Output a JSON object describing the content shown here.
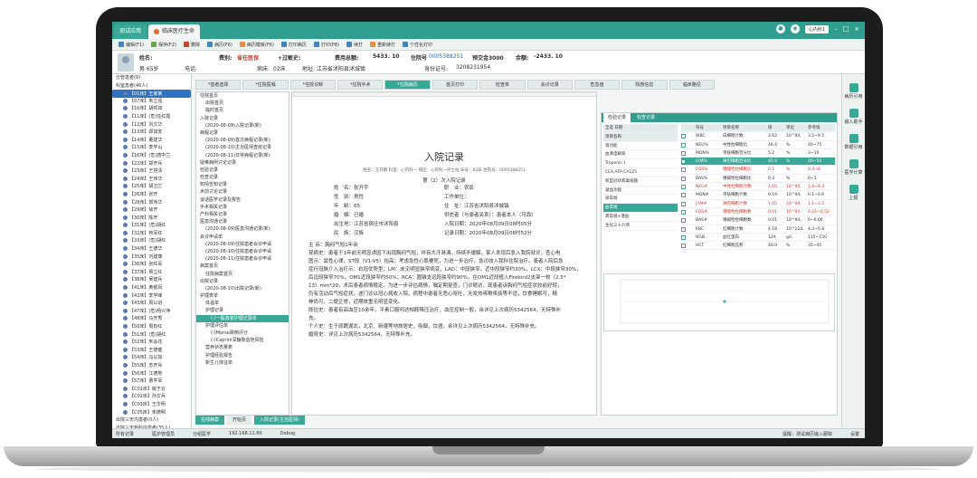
{
  "tabs": [
    {
      "label": "测试应用"
    },
    {
      "label": "临床医疗生命"
    }
  ],
  "topright": {
    "dept": "心内科1"
  },
  "toolbar": [
    {
      "label": "编辑(F1)",
      "c": ""
    },
    {
      "label": "保存(F2)",
      "c": "g"
    },
    {
      "label": "删除",
      "c": "r"
    },
    {
      "label": "病历(F6)",
      "c": ""
    },
    {
      "label": "病历模板(F6)",
      "c": "o"
    },
    {
      "label": "打印病历",
      "c": ""
    },
    {
      "label": "打印(P8)",
      "c": ""
    },
    {
      "label": "续打",
      "c": ""
    },
    {
      "label": "重新续打",
      "c": "o"
    },
    {
      "label": "个性化打印",
      "c": ""
    }
  ],
  "patient": {
    "name_label": "姓名:",
    "gender_age": "男  65岁",
    "phone_label": "电话:",
    "fee_type_label": "费别:",
    "fee_type": "省任医保",
    "allergy_label": "+过敏史:",
    "ward_label": "病床:",
    "ward": "02床",
    "address": "地址: 江苏省沭阳县沭城镇",
    "total_label": "费用总额:",
    "total": "5433. 10",
    "inpatient_label": "住院号",
    "inpatient_no": "0005388251",
    "deposit_label": "预交金3000",
    "balance_label": "余额:",
    "balance": "-2433. 10",
    "id_label": "身份证号:",
    "id_no": "3208231954"
  },
  "left_tree": [
    {
      "t": "分管患者(0)",
      "grp": true
    },
    {
      "t": "科室患者(46人)",
      "grp": true
    },
    {
      "t": "【01床】王某某",
      "sel": true
    },
    {
      "t": "【07床】朱立强"
    },
    {
      "t": "【10床】胡邦如"
    },
    {
      "t": "【11床】(危)任红霞"
    },
    {
      "t": "【12床】刘文华"
    },
    {
      "t": "【13床】郑如安"
    },
    {
      "t": "【14床】董建华"
    },
    {
      "t": "【15床】李学山"
    },
    {
      "t": "【16床】(危)唐中兰"
    },
    {
      "t": "【22床】郑开兵"
    },
    {
      "t": "【23床】王悦清"
    },
    {
      "t": "【24床】王伟华"
    },
    {
      "t": "【25床】胡卫兰"
    },
    {
      "t": "【26床】张开"
    },
    {
      "t": "【28床】郭伟华"
    },
    {
      "t": "【29床】徐开"
    },
    {
      "t": "【30床】陈开"
    },
    {
      "t": "【31床】(危)胡红"
    },
    {
      "t": "【32床】蒋军红"
    },
    {
      "t": "【33床】(危)胡红"
    },
    {
      "t": "【34床】王德华"
    },
    {
      "t": "【35床】刘建康"
    },
    {
      "t": "【36床】张红军"
    },
    {
      "t": "【37床】周立红"
    },
    {
      "t": "【38床】吴建兵"
    },
    {
      "t": "【41床】黄银凤"
    },
    {
      "t": "【42床】李学峰"
    },
    {
      "t": "【43床】周以进"
    },
    {
      "t": "【47床】(危)杨兴萍"
    },
    {
      "t": "【48床】马开秀"
    },
    {
      "t": "【50床】周有红"
    },
    {
      "t": "【51床】(危)胡红"
    },
    {
      "t": "【52床】朱会花"
    },
    {
      "t": "【53床】王德健"
    },
    {
      "t": "【54床】马以加"
    },
    {
      "t": "【55床】苏开兵"
    },
    {
      "t": "【56床】江德地"
    },
    {
      "t": "【57床】曹学军"
    },
    {
      "t": "【C01床】姚于云"
    },
    {
      "t": "【C02床】孙文兵"
    },
    {
      "t": "【C03床】王华明"
    },
    {
      "t": "【C05床】朱德明"
    },
    {
      "t": "出院三天内患者(0人)",
      "grp": true
    },
    {
      "t": "出院三天到科内患者(35人)",
      "grp": true
    },
    {
      "t": "08-13【内科】陈月芳"
    },
    {
      "t": "08-12【内科】李红"
    },
    {
      "t": "08-11【内科】廖振远"
    }
  ],
  "navtabs": [
    {
      "t": "*患者选择"
    },
    {
      "t": "*住院医嘱"
    },
    {
      "t": "*住院诊断"
    },
    {
      "t": "*住院手术"
    },
    {
      "t": "*住院病历",
      "active": true
    },
    {
      "t": "首页打印"
    },
    {
      "t": "检查单"
    },
    {
      "t": "会诊记录"
    },
    {
      "t": "危急值"
    },
    {
      "t": "院感信息"
    },
    {
      "t": "临床路径"
    }
  ],
  "doctree": [
    {
      "t": "住院首页",
      "l": 1
    },
    {
      "t": "出院首页",
      "l": 2
    },
    {
      "t": "临时首页",
      "l": 2
    },
    {
      "t": "入院记录",
      "l": 1
    },
    {
      "t": "(2020-08-09)入院记录(新)",
      "l": 2
    },
    {
      "t": "病程记录",
      "l": 1
    },
    {
      "t": "(2020-08-09)首次病程记录(新)",
      "l": 2
    },
    {
      "t": "(2020-08-10)主治医师查房记录",
      "l": 2
    },
    {
      "t": "(2020-08-11)日常病程记录(新)",
      "l": 2
    },
    {
      "t": "疑难病例讨论记录",
      "l": 1
    },
    {
      "t": "检验记录",
      "l": 1
    },
    {
      "t": "检查记录",
      "l": 1
    },
    {
      "t": "知情告知记录",
      "l": 1
    },
    {
      "t": "术前讨论记录",
      "l": 1
    },
    {
      "t": "谈话医学记录及报告",
      "l": 1
    },
    {
      "t": "手术相关记录",
      "l": 1
    },
    {
      "t": "产科相关记录",
      "l": 1
    },
    {
      "t": "医患沟通记录",
      "l": 1
    },
    {
      "t": "(2020-08-09)医患沟通记录(新)",
      "l": 2
    },
    {
      "t": "会诊申请单",
      "l": 1
    },
    {
      "t": "(2020-08-09)住院患者会诊申请",
      "l": 2
    },
    {
      "t": "(2020-08-10)住院患者会诊申请",
      "l": 2
    },
    {
      "t": "(2020-08-11)住院患者会诊申请",
      "l": 2
    },
    {
      "t": "病案首页",
      "l": 1
    },
    {
      "t": "住院病案首页",
      "l": 2
    },
    {
      "t": "出院记录",
      "l": 1
    },
    {
      "t": "(2020-08-10)出院记录(新)",
      "l": 2
    },
    {
      "t": "护理表单",
      "l": 1
    },
    {
      "t": "体温单",
      "l": 2
    },
    {
      "t": "护理记录",
      "l": 2
    },
    {
      "t": "(-)一般患者护理记录单",
      "l": 3,
      "hl": true
    },
    {
      "t": "护理评估单",
      "l": 2
    },
    {
      "t": "(-)Morse跌倒评分",
      "l": 3
    },
    {
      "t": "(-)Caprini深静脉血栓风险",
      "l": 3
    },
    {
      "t": "营养状态量表",
      "l": 2
    },
    {
      "t": "护理经验报告",
      "l": 2
    },
    {
      "t": "新生儿体征单",
      "l": 2
    }
  ],
  "editor": {
    "title": "入院记录",
    "subtitle": "姓名：王开鹏   科室：心内科一   病区：心内科一护士站   床号：02床   住院号：0005388251",
    "ordinal": "第（2）次入院记录",
    "fields": [
      "姓　名：张开宇",
      "职　业：农民",
      "性　别：男性",
      "工作单位：",
      "年　龄：65",
      "住　址：江苏省沭阳县沭城镇",
      "婚　姻：已婚",
      "供史者（与患者关系）：患者本人（可靠）",
      "出生地：江苏省宿迁市沭阳县",
      "入院日期：2020年08月09日08时05分",
      "民　族：汉族",
      "记录日期：2020年08月09日08时52分"
    ],
    "lines": [
      "主  诉：胸闷气短1年余",
      "现病史：患者于1年前无明显诱因下出现胸闷气短，伴有大汗淋漓，持续不缓解，家人发现后急入我院就诊，查心电",
      "图示：窦性心律，ST段（V1-V5）抬高；考虑急性心肌梗死，为进一步治疗，急诊收入我科住院治疗。患者入院后急",
      "症行冠脉介入治疗示：右冠优势型；LM：未见明显狭窄病变，LAD：中段狭窄，近中段狭窄约30%，LCX：中段狭窄30%，",
      "后远段狭窄70%，OM1近段狭窄约50%；RCA：圆锥支远段狭窄约90%，在OM1近段植入Firebird2支架一枚（2.5*",
      "13）mm*29，术后患者病情稳定。为进一步评估病情，嘱定期复查，门诊随访，现患者诉胸闷气短症状较前好转，",
      "仍有活动后气短症状，遂门诊以冠心病收入院。病程中患者无恶心呕吐，无发热咳嗽咳痰等不适，饮食睡眠可，精",
      "神尚可，二便正常，近期体重无明显变化。",
      "既往史：患者有高血压10余年，平素口服吲达帕胺降压治疗，血压控制一般，余详见上次病历5342564，无特殊补",
      "充。",
      "个人史：生于原籍湖北，北京、新疆等地旅居史，吸烟，饮酒，余详见上次病历5342564，无特殊补充。",
      "婚育史：详见上次病历5342564，无特殊补充。"
    ]
  },
  "right": {
    "tabs": [
      {
        "t": "检验记录",
        "active": true
      },
      {
        "t": "检查记录"
      }
    ],
    "lab_list": [
      {
        "t": "全选  日期",
        "hd": true
      },
      {
        "t": "项目名称",
        "hd": true
      },
      {
        "t": "肾功能"
      },
      {
        "t": "血清电解质"
      },
      {
        "t": "Troponin I"
      },
      {
        "t": "CEA,AFP,CA125"
      },
      {
        "t": "新型冠状病毒核酸"
      },
      {
        "t": "凝血功能"
      },
      {
        "t": "尿常规"
      },
      {
        "t": "血常规",
        "hl": true
      },
      {
        "t": "粪常规+潜血"
      },
      {
        "t": "生化三十六项"
      }
    ],
    "results": [
      {
        "n": "符号",
        "name": "项目名称",
        "v": "值",
        "u": "单位",
        "f": "",
        "r": "参考值",
        "hd": true
      },
      {
        "n": "WBC",
        "name": "白细胞计数",
        "v": "3.62",
        "u": "10^9/L",
        "f": "",
        "r": "3.5~9.5"
      },
      {
        "n": "NEU%",
        "name": "中性粒细胞比",
        "v": "46.4",
        "u": "%",
        "f": "",
        "r": "40~75"
      },
      {
        "n": "MON%",
        "name": "单核细胞百分比",
        "v": "5.2",
        "u": "%",
        "f": "",
        "r": "3~10"
      },
      {
        "n": "LYM%",
        "name": "淋巴细胞百分比",
        "v": "45.4",
        "u": "%",
        "f": "↑",
        "r": "20~50",
        "hl": true
      },
      {
        "n": "EOS%",
        "name": "嗜酸性粒细胞比",
        "v": "0.2",
        "u": "%",
        "f": "↓",
        "r": "0.4~8",
        "bad": true
      },
      {
        "n": "BAS%",
        "name": "嗜碱性粒细胞比",
        "v": "0.3",
        "u": "%",
        "f": "",
        "r": "0~1"
      },
      {
        "n": "NEU#",
        "name": "中性粒细胞计数",
        "v": "1.05",
        "u": "10^9/L",
        "f": "↓",
        "r": "1.8~6.3",
        "bad": true
      },
      {
        "n": "MON#",
        "name": "单核细胞计数",
        "v": "0.19",
        "u": "10^9/L",
        "f": "",
        "r": "0.1~0.6"
      },
      {
        "n": "LYM#",
        "name": "淋巴细胞计数",
        "v": "1.05",
        "u": "10^9/L",
        "f": "↓",
        "r": "1.1~3.2",
        "bad": true
      },
      {
        "n": "EOS#",
        "name": "嗜酸性粒细胞数",
        "v": "0.01",
        "u": "10^9/L",
        "f": "↓",
        "r": "0.02~0.52",
        "bad": true
      },
      {
        "n": "BAS#",
        "name": "嗜碱性粒细胞数",
        "v": "0.01",
        "u": "10^9/L",
        "f": "",
        "r": "0~0.06"
      },
      {
        "n": "RBC",
        "name": "红细胞计数",
        "v": "4.18",
        "u": "10^12/L",
        "f": "",
        "r": "4.3~5.8"
      },
      {
        "n": "HGB",
        "name": "血红蛋白",
        "v": "129",
        "u": "g/L",
        "f": "",
        "r": "115~150"
      },
      {
        "n": "HCT",
        "name": "红细胞压积",
        "v": "40.0",
        "u": "%",
        "f": "",
        "r": "35~45"
      }
    ]
  },
  "farright": [
    {
      "t": "病历引用"
    },
    {
      "t": "输入助手"
    },
    {
      "t": "数据引用"
    },
    {
      "t": "医学计算"
    },
    {
      "t": "上报"
    }
  ],
  "bottomtabs": [
    {
      "t": "在线病案",
      "g": true
    },
    {
      "t": "开始页"
    },
    {
      "t": "入院记录(主治医师)",
      "g": true
    }
  ],
  "status": {
    "db": "所有记录",
    "s1": "医护管理员",
    "s2": "分组医学",
    "ip": "192.168.11.80",
    "mode": "Debug",
    "right": "提醒：测试病历输入跟踪",
    "set": "设置"
  }
}
